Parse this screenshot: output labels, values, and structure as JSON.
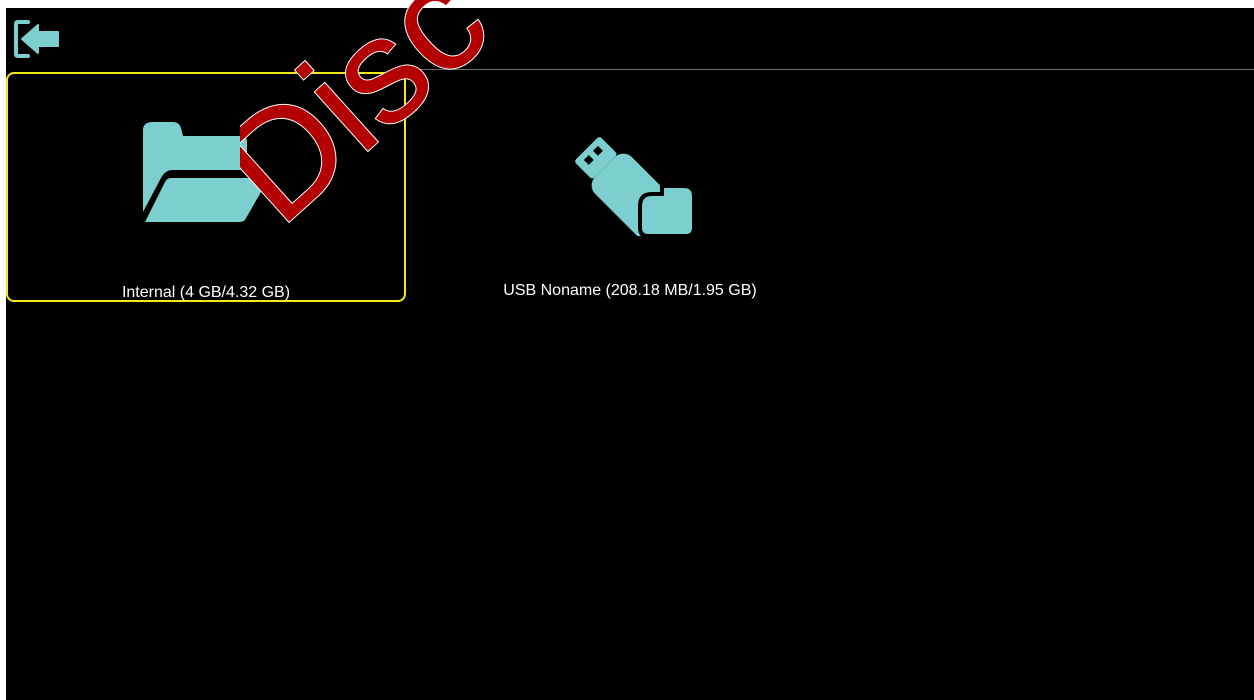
{
  "header": {
    "back_icon": "exit-arrow-icon"
  },
  "storage": [
    {
      "label": "Internal (4 GB/4.32 GB)",
      "icon": "folder-open-icon",
      "selected": true
    },
    {
      "label": "USB Noname (208.18 MB/1.95 GB)",
      "icon": "usb-drive-icon",
      "selected": false
    }
  ],
  "watermark": {
    "text": "Disc"
  },
  "colors": {
    "background": "#000000",
    "icon": "#7dcfcf",
    "selection": "#f2ea1e",
    "watermark": "#b30000"
  }
}
